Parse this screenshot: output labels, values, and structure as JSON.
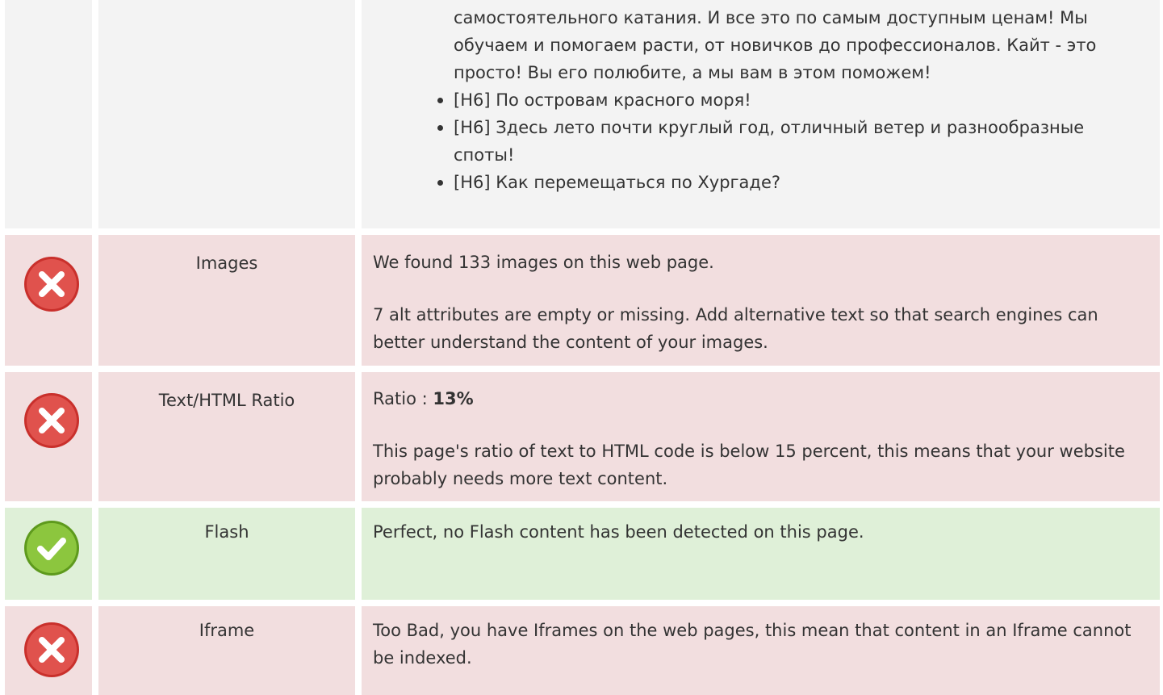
{
  "headings": {
    "items": [
      {
        "text": "самостоятельного катания. И все это по самым доступным ценам! Мы обучаем и помогаем расти, от новичков до профессионалов. Кайт - это просто! Вы его полюбите, а мы вам в этом поможем!",
        "bullet": false
      },
      {
        "text": "[H6] По островам красного моря!",
        "bullet": true
      },
      {
        "text": "[H6] Здесь лето почти круглый год, отличный ветер и разнообразные споты!",
        "bullet": true
      },
      {
        "text": "[H6] Как перемещаться по Хургаде?",
        "bullet": true
      }
    ]
  },
  "checks": {
    "images": {
      "status": "fail",
      "name": "Images",
      "line1": "We found 133 images on this web page.",
      "line2": "7 alt attributes are empty or missing. Add alternative text so that search engines can better understand the content of your images."
    },
    "ratio": {
      "status": "fail",
      "name": "Text/HTML Ratio",
      "line1_label": "Ratio : ",
      "line1_value": "13%",
      "line2": "This page's ratio of text to HTML code is below 15 percent, this means that your website probably needs more text content."
    },
    "flash": {
      "status": "pass",
      "name": "Flash",
      "line1": "Perfect, no Flash content has been detected on this page."
    },
    "iframe": {
      "status": "fail",
      "name": "Iframe",
      "line1": "Too Bad, you have Iframes on the web pages, this mean that content in an Iframe cannot be indexed."
    }
  },
  "colors": {
    "fail_bg": "#f2dedf",
    "pass_bg": "#dff0d8",
    "neutral_bg": "#f3f3f3",
    "fail_icon": "#d9534f",
    "pass_icon": "#7cb82f",
    "text": "#333333"
  },
  "icons": {
    "fail": "error-x-icon",
    "pass": "check-icon"
  }
}
